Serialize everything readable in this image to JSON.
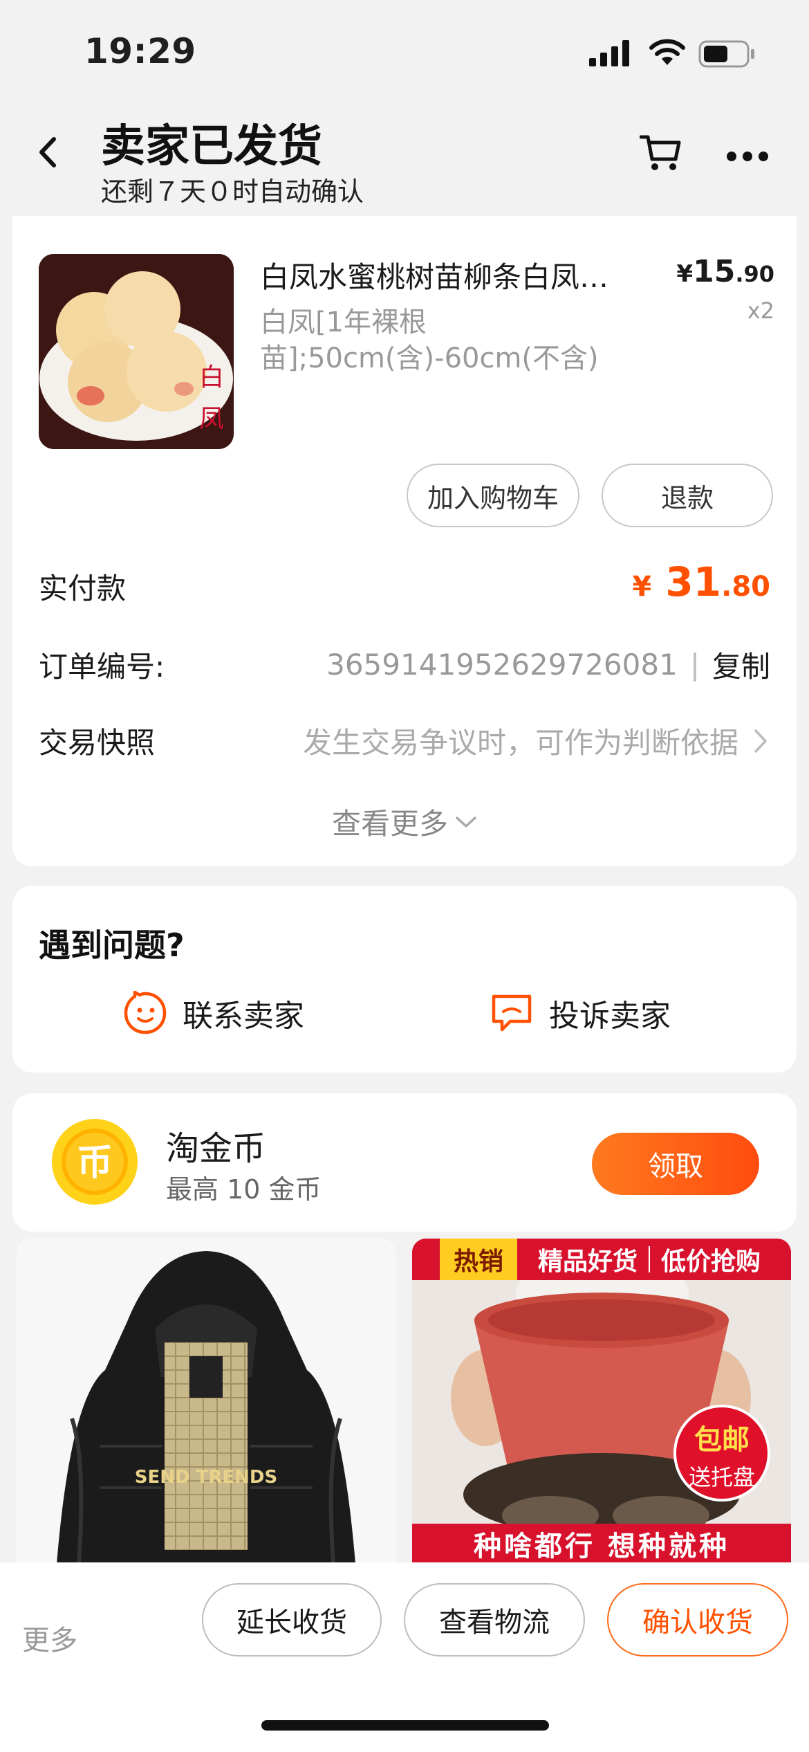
{
  "status_bar": {
    "time": "19:29"
  },
  "header": {
    "title": "卖家已发货",
    "subtitle": "还剩７天０时自动确认"
  },
  "product": {
    "title": "白凤水蜜桃树苗柳条白凤…",
    "sku": "白凤[1年裸根苗];50cm(含)-60cm(不含)",
    "price_symbol": "¥",
    "price_int": "15",
    "price_dec": ".90",
    "quantity": "x2",
    "image_text": "白 凤"
  },
  "actions": {
    "add_to_cart": "加入购物车",
    "refund": "退款"
  },
  "order": {
    "paid_label": "实付款",
    "paid_symbol": "¥",
    "paid_int": "31",
    "paid_dec": ".80",
    "order_no_label": "订单编号:",
    "order_no": "3659141952629726081",
    "separator": "|",
    "copy": "复制",
    "snapshot_label": "交易快照",
    "snapshot_hint": "发生交易争议时，可作为判断依据",
    "view_more": "查看更多"
  },
  "problem": {
    "title": "遇到问题?",
    "contact_seller": "联系卖家",
    "complain_seller": "投诉卖家"
  },
  "coin": {
    "title": "淘金币",
    "subtitle": "最高 10 金币",
    "claim": "领取",
    "icon_glyph": "币"
  },
  "recommendations": {
    "jacket_text": "SEND TRENDS",
    "pot_hot": "热销",
    "pot_banner_1": "精品好货",
    "pot_banner_2": "低价抢购",
    "pot_badge_1": "包邮",
    "pot_badge_2": "送托盘",
    "pot_bottom": "种啥都行 想种就种"
  },
  "bottom_bar": {
    "more": "更多",
    "extend": "延长收货",
    "logistics": "查看物流",
    "confirm": "确认收货"
  },
  "colors": {
    "accent": "#ff5000",
    "page_bg": "#f2f2f2",
    "promo_red": "#d8112c"
  }
}
